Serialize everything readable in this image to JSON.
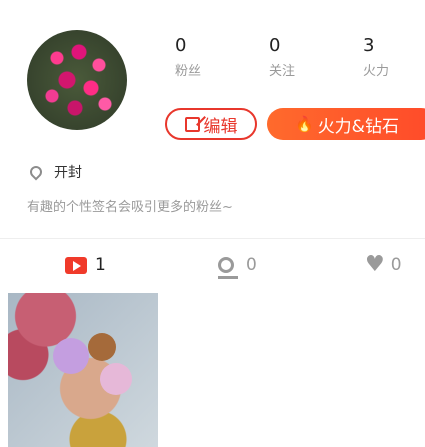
{
  "profile": {
    "stats": [
      {
        "value": "0",
        "label": "粉丝"
      },
      {
        "value": "0",
        "label": "关注"
      },
      {
        "value": "3",
        "label": "火力"
      }
    ],
    "edit_label": "编辑",
    "fire_label": "火力&钻石",
    "location": "开封",
    "bio": "有趣的个性签名会吸引更多的粉丝~"
  },
  "tabs": [
    {
      "name": "videos",
      "icon": "video-icon",
      "count": "1"
    },
    {
      "name": "locations",
      "icon": "location-icon",
      "count": "0"
    },
    {
      "name": "likes",
      "icon": "heart-icon",
      "count": "0"
    }
  ],
  "colors": {
    "accent": "#e8372c",
    "fire_gradient_start": "#ff6a2c"
  }
}
